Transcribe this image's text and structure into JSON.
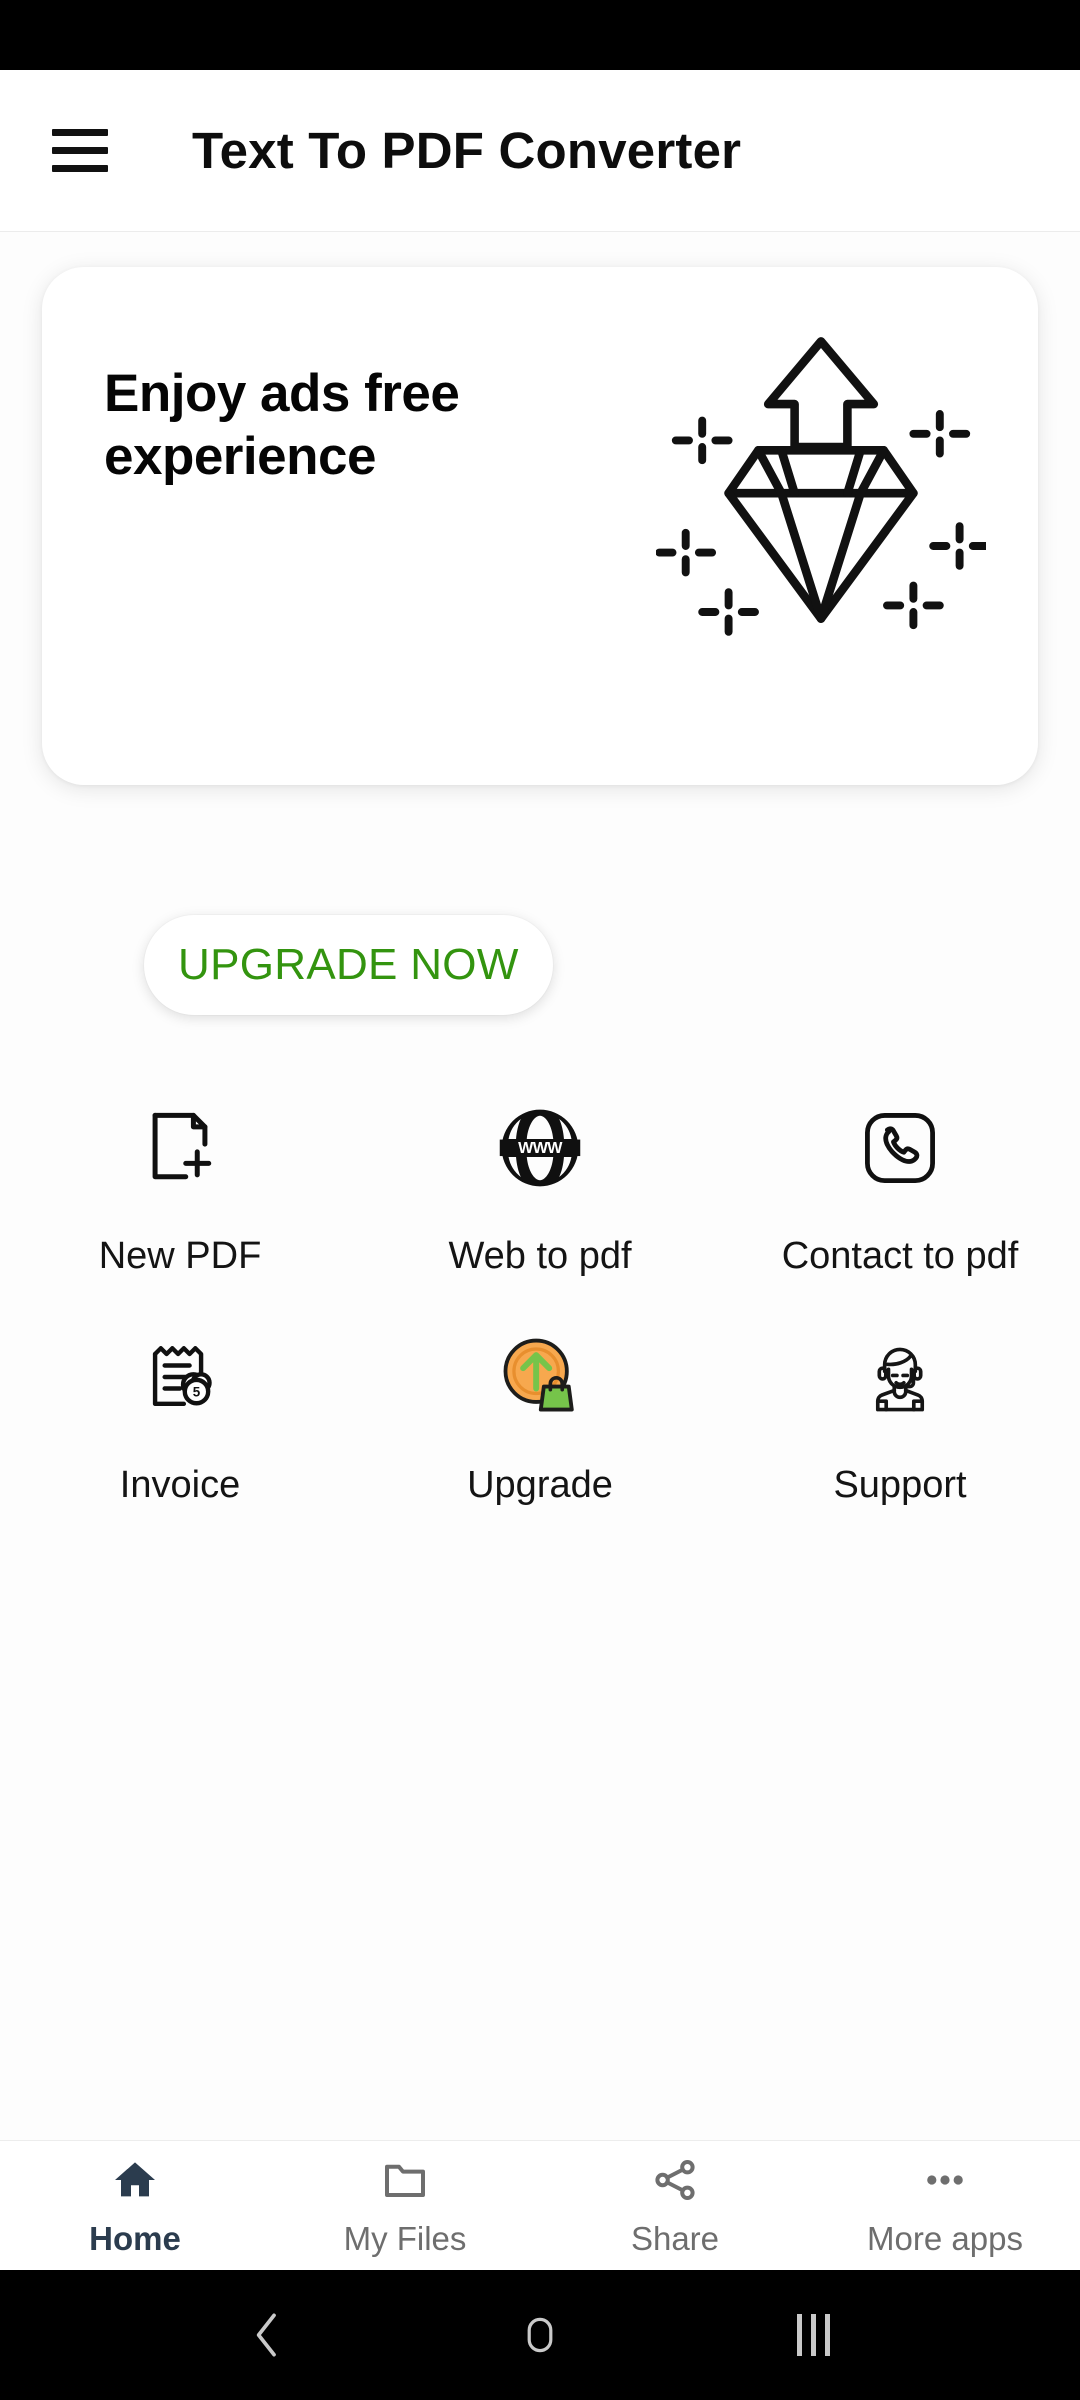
{
  "app": {
    "title": "Text To PDF Converter",
    "menu_icon": "hamburger-menu-icon"
  },
  "promo": {
    "title_line1": "Enjoy ads free",
    "title_line2": "experience",
    "button_label": "UPGRADE NOW",
    "button_text_color": "#33940f",
    "illustration_icon": "diamond-upgrade-icon"
  },
  "features": [
    {
      "label": "New PDF",
      "icon": "document-add-icon"
    },
    {
      "label": "Web to pdf",
      "icon": "globe-www-icon"
    },
    {
      "label": "Contact to pdf",
      "icon": "phone-square-icon"
    },
    {
      "label": "Invoice",
      "icon": "receipt-coins-icon"
    },
    {
      "label": "Upgrade",
      "icon": "upgrade-coin-bag-icon"
    },
    {
      "label": "Support",
      "icon": "headset-agent-icon"
    }
  ],
  "bottom_nav": {
    "active_color": "#2b3c4e",
    "inactive_color": "#6e6e6e",
    "items": [
      {
        "label": "Home",
        "icon": "home-icon",
        "active": true
      },
      {
        "label": "My Files",
        "icon": "folder-icon",
        "active": false
      },
      {
        "label": "Share",
        "icon": "share-icon",
        "active": false
      },
      {
        "label": "More apps",
        "icon": "more-dots-icon",
        "active": false
      }
    ]
  },
  "system_nav": {
    "back": "back-chevron-icon",
    "home": "home-square-icon",
    "recents": "recents-lines-icon"
  }
}
